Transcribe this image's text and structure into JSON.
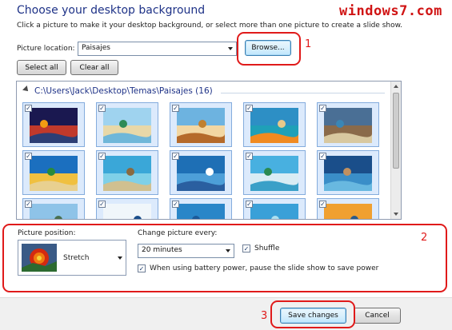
{
  "header": {
    "title": "Choose your desktop background",
    "watermark": "windows7.com",
    "description": "Click a picture to make it your desktop background, or select more than one picture to create a slide show."
  },
  "location": {
    "label": "Picture location:",
    "value": "Paisajes",
    "browse_label": "Browse..."
  },
  "selection": {
    "select_all_label": "Select all",
    "clear_all_label": "Clear all"
  },
  "gallery": {
    "folder_path": "C:\\Users\\Jack\\Desktop\\Temas\\Paisajes (16)",
    "items": [
      {
        "name": "sunset-island",
        "checked": true
      },
      {
        "name": "bottle-beach",
        "checked": true
      },
      {
        "name": "shell-sand",
        "checked": true
      },
      {
        "name": "starfish-beach",
        "checked": true
      },
      {
        "name": "rock-arch-coast",
        "checked": true
      },
      {
        "name": "palm-beach",
        "checked": true
      },
      {
        "name": "pier-lagoon",
        "checked": true
      },
      {
        "name": "ocean-horizon",
        "checked": true
      },
      {
        "name": "tropical-island",
        "checked": true
      },
      {
        "name": "overwater-villa",
        "checked": true
      },
      {
        "name": "cliffs-sea",
        "checked": true
      },
      {
        "name": "sailboat",
        "checked": true
      },
      {
        "name": "blue-sea",
        "checked": true
      },
      {
        "name": "lagoon-blue",
        "checked": true
      },
      {
        "name": "sunset-palms",
        "checked": true
      }
    ]
  },
  "position": {
    "label": "Picture position:",
    "value": "Stretch"
  },
  "slideshow": {
    "interval_label": "Change picture every:",
    "interval_value": "20 minutes",
    "shuffle_label": "Shuffle",
    "shuffle_checked": true,
    "battery_label": "When using battery power, pause the slide show to save power",
    "battery_checked": true
  },
  "annotations": {
    "n1": "1",
    "n2": "2",
    "n3": "3",
    "color": "#e01a1a"
  },
  "footer": {
    "save_label": "Save changes",
    "cancel_label": "Cancel"
  }
}
